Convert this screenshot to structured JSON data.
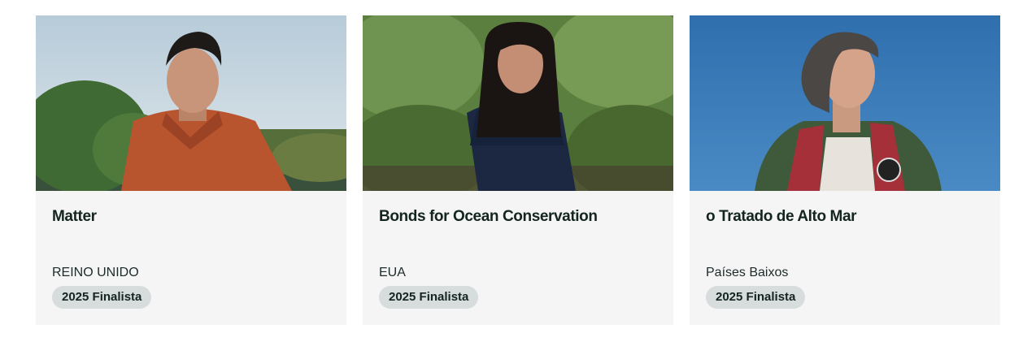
{
  "cards": [
    {
      "title": "Matter",
      "country": "REINO UNIDO",
      "badge": "2025 Finalista",
      "photo_alt": "portrait-man-orange-jacket",
      "colors": {
        "sky": "#c6d6e0",
        "foliage": "#4f7a3c",
        "jacket": "#b8552f",
        "skin": "#c8957a",
        "hair": "#1e1a18"
      }
    },
    {
      "title": "Bonds for Ocean Conservation",
      "country": "EUA",
      "badge": "2025 Finalista",
      "photo_alt": "portrait-woman-mangrove",
      "colors": {
        "foliage": "#5b7f3e",
        "shirt": "#1c2742",
        "skin": "#c48e74",
        "hair": "#1a1413"
      }
    },
    {
      "title": "o Tratado de Alto Mar",
      "country": "Países Baixos",
      "badge": "2025 Finalista",
      "photo_alt": "portrait-woman-blue-sky",
      "colors": {
        "sky": "#3c7cb8",
        "vest": "#a5303a",
        "coat": "#3e5a3a",
        "skin": "#d5a389",
        "hair": "#4b4744"
      }
    }
  ]
}
